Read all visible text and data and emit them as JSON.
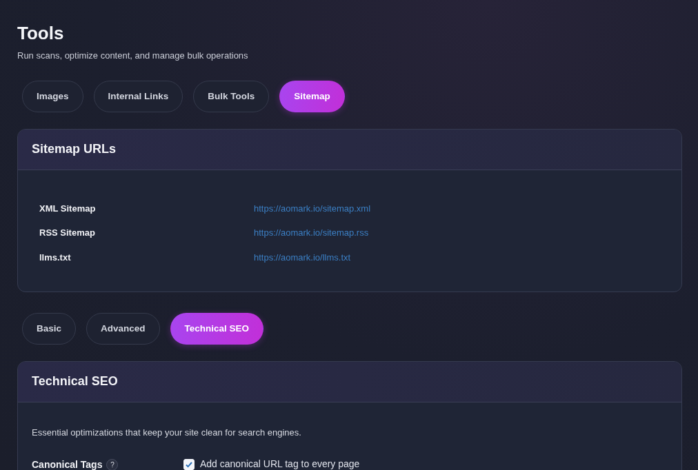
{
  "page": {
    "title": "Tools",
    "subtitle": "Run scans, optimize content, and manage bulk operations"
  },
  "tabs": [
    {
      "label": "Images",
      "selected": false
    },
    {
      "label": "Internal Links",
      "selected": false
    },
    {
      "label": "Bulk Tools",
      "selected": false
    },
    {
      "label": "Sitemap",
      "selected": true
    }
  ],
  "sitemap_card": {
    "title": "Sitemap URLs",
    "rows": [
      {
        "label": "XML Sitemap",
        "url": "https://aomark.io/sitemap.xml"
      },
      {
        "label": "RSS Sitemap",
        "url": "https://aomark.io/sitemap.rss"
      },
      {
        "label": "llms.txt",
        "url": "https://aomark.io/llms.txt"
      }
    ]
  },
  "sub_tabs": [
    {
      "label": "Basic",
      "selected": false
    },
    {
      "label": "Advanced",
      "selected": false
    },
    {
      "label": "Technical SEO",
      "selected": true
    }
  ],
  "seo_card": {
    "title": "Technical SEO",
    "description": "Essential optimizations that keep your site clean for search engines.",
    "settings": [
      {
        "label": "Canonical Tags",
        "help": "?",
        "option": "Add canonical URL tag to every page",
        "checked": true
      }
    ]
  }
}
